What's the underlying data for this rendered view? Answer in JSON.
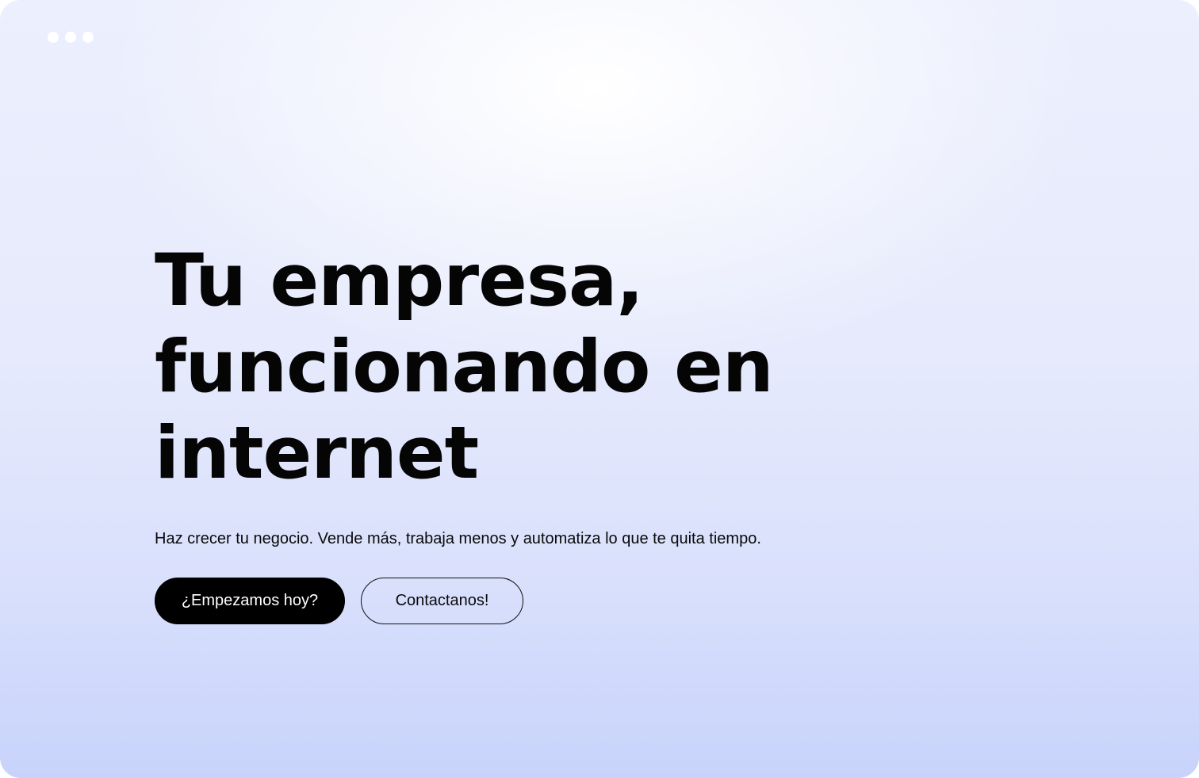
{
  "window": {
    "controls": [
      "dot",
      "dot",
      "dot"
    ]
  },
  "hero": {
    "title": "Tu empresa, funcionando en internet",
    "subtitle": "Haz crecer tu negocio. Vende más, trabaja menos y automatiza lo que te quita tiempo.",
    "primary_button_label": "¿Empezamos hoy?",
    "secondary_button_label": "Contactanos!"
  },
  "colors": {
    "primary_button_bg": "#000000",
    "primary_button_text": "#ffffff",
    "background_top": "#eceffd",
    "background_bottom": "#c8d3fb"
  }
}
